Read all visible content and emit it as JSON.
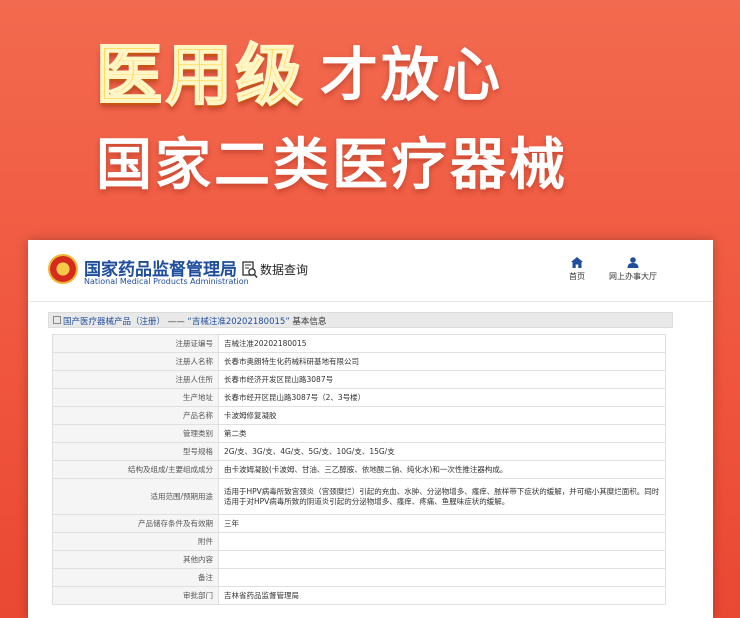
{
  "banner": {
    "headline_gold": "医用级",
    "headline_white": "才放心",
    "subline": "国家二类医疗器械"
  },
  "site": {
    "agency_name": "国家药品监督管理局",
    "agency_name_en": "National Medical Products Administration",
    "data_query": "数据查询",
    "nav_home": "首页",
    "nav_online_hall": "网上办事大厅"
  },
  "breadcrumb": {
    "section": "国产医疗器械产品（注册）",
    "separator": "——",
    "record": "“吉械注准20202180015”",
    "suffix": "基本信息"
  },
  "record_table": [
    {
      "label": "注册证编号",
      "value": "吉械注准20202180015"
    },
    {
      "label": "注册人名称",
      "value": "长春市奥朗特生化药械科研基地有限公司"
    },
    {
      "label": "注册人住所",
      "value": "长春市经济开发区昆山路3087号"
    },
    {
      "label": "生产地址",
      "value": "长春市经开区昆山路3087号（2、3号楼）"
    },
    {
      "label": "产品名称",
      "value": "卡波姆修复凝胶"
    },
    {
      "label": "管理类别",
      "value": "第二类"
    },
    {
      "label": "型号规格",
      "value": "2G/支、3G/支、4G/支、5G/支、10G/支、15G/支"
    },
    {
      "label": "结构及组成/主要组成成分",
      "value": "由卡波姆凝胶(卡波姆、甘油、三乙醇胺、依地酸二钠、纯化水)和一次性推注器构成。"
    },
    {
      "label": "适用范围/预期用途",
      "value": "适用于HPV病毒所致宫颈炎（宫颈糜烂）引起的充血、水肿、分泌物增多、瘙痒、脓样带下症状的缓解，并可缩小其糜烂面积。同时适用于对HPV病毒所致的阴道炎引起的分泌物增多、瘙痒、疼痛、鱼腥味症状的缓解。"
    },
    {
      "label": "产品储存条件及有效期",
      "value": "三年"
    },
    {
      "label": "附件",
      "value": ""
    },
    {
      "label": "其他内容",
      "value": ""
    },
    {
      "label": "备注",
      "value": ""
    },
    {
      "label": "审批部门",
      "value": "吉林省药品监督管理局"
    }
  ],
  "colors": {
    "background": "#f0553d",
    "headline_gold": "#ffd23a",
    "agency_blue": "#1f4e9c"
  }
}
